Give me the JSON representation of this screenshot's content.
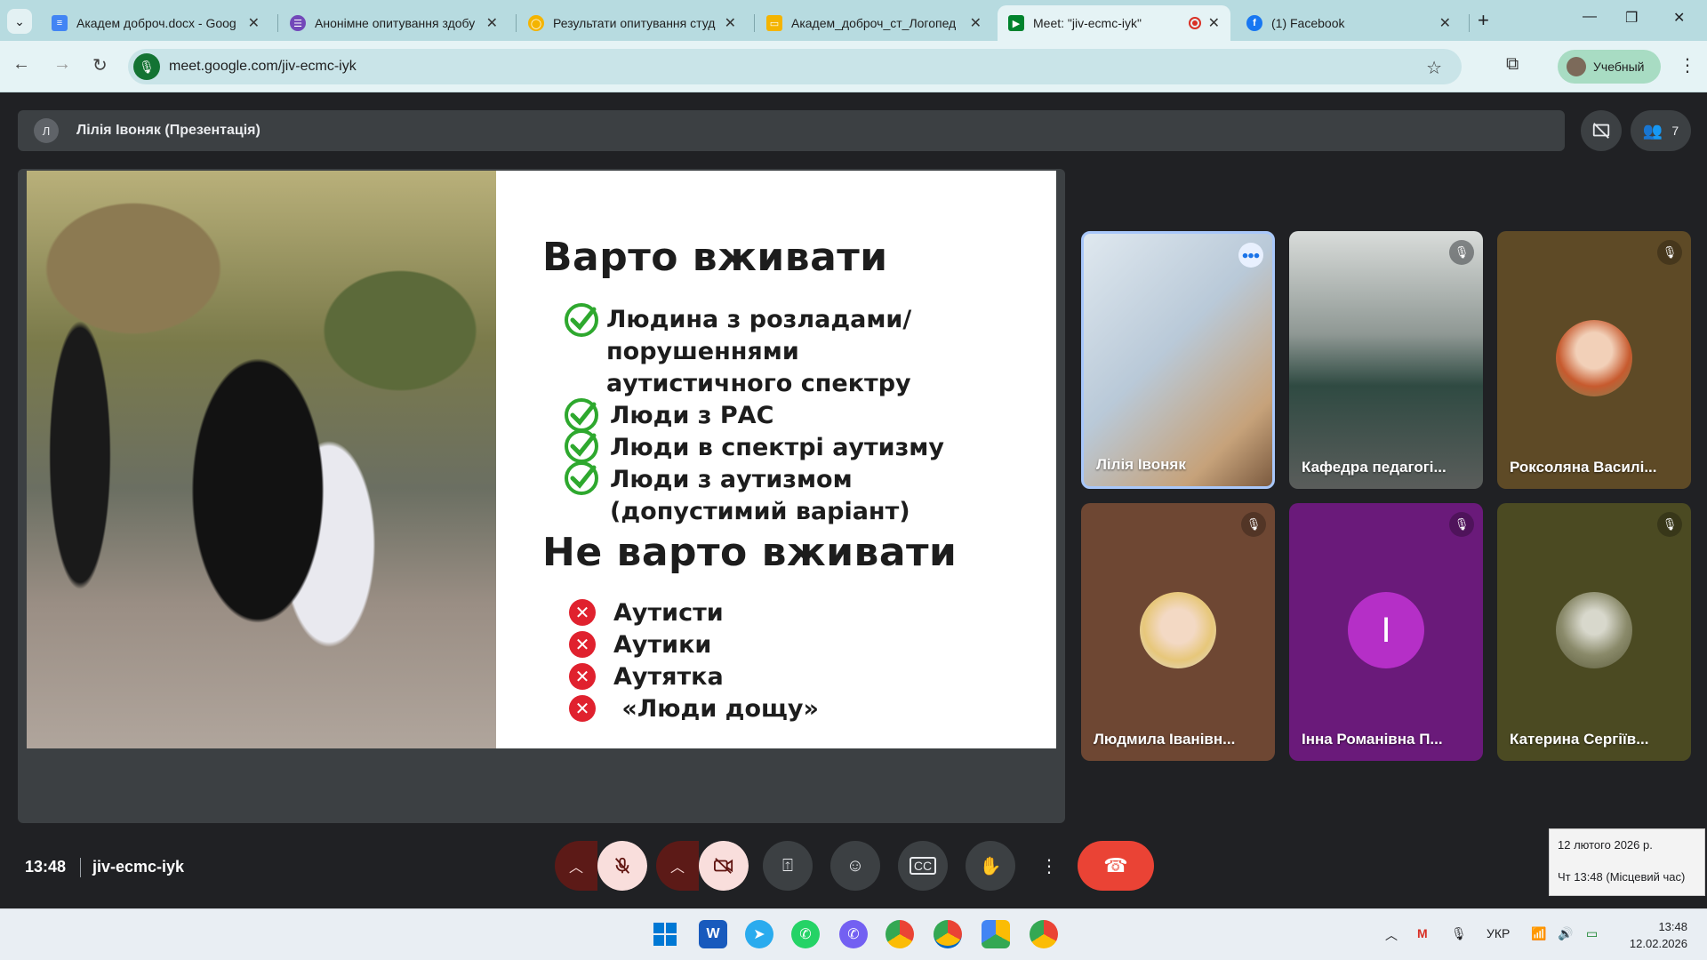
{
  "browser": {
    "tabs": [
      {
        "title": "Академ доброч.docx - Goog",
        "favicon_color": "#4285f4"
      },
      {
        "title": "Анонімне опитування здобу",
        "favicon_color": "#7248b9"
      },
      {
        "title": "Результати опитування студ",
        "favicon_color": "#f4b400"
      },
      {
        "title": "Академ_доброч_ст_Логопед",
        "favicon_color": "#f4b400"
      },
      {
        "title": "Meet: \"jiv-ecmc-iyk\"",
        "favicon_color": "#00832d"
      },
      {
        "title": "(1) Facebook",
        "favicon_color": "#1877f2"
      }
    ],
    "url": "meet.google.com/jiv-ecmc-iyk",
    "profile_label": "Учебный"
  },
  "meet": {
    "presenter_initial": "Л",
    "presenter_label": "Лілія Івоняк (Презентація)",
    "participant_count": "7",
    "slide": {
      "heading_do": "Варто вживати",
      "do_items": [
        "Людина з розладами/ порушеннями аутистичного спектру",
        "Люди з РАС",
        "Люди в спектрі аутизму",
        "Люди з аутизмом (допустимий варіант)"
      ],
      "heading_dont": "Не варто вживати",
      "dont_items": [
        "Аутисти",
        "Аутики",
        "Аутятка",
        " «Люди дощу»"
      ]
    },
    "participants": [
      {
        "name": "Лілія Івоняк",
        "bg": "#c9d6e3",
        "type": "video"
      },
      {
        "name": "Кафедра педагогі...",
        "bg": "#6d7470",
        "type": "video"
      },
      {
        "name": "Роксоляна Василі...",
        "bg": "#5e4a26",
        "type": "photo"
      },
      {
        "name": "Людмила Іванівн...",
        "bg": "#6e4733",
        "type": "photo"
      },
      {
        "name": "Інна Романівна П...",
        "bg": "#6a1a7a",
        "type": "letter",
        "letter": "І"
      },
      {
        "name": "Катерина Сергіїв...",
        "bg": "#4b4a22",
        "type": "photo"
      }
    ],
    "meeting_time": "13:48",
    "meeting_code": "jiv-ecmc-iyk"
  },
  "datetime_tooltip": {
    "line1": "12 лютого 2026 р.",
    "line2": "Чт 13:48 (Місцевий час)"
  },
  "taskbar": {
    "language": "УКР",
    "time": "13:48",
    "date": "12.02.2026"
  },
  "colors": {
    "accent_end_call": "#ea4335",
    "check_green": "#2ea82e",
    "cross_red": "#e0212e"
  }
}
